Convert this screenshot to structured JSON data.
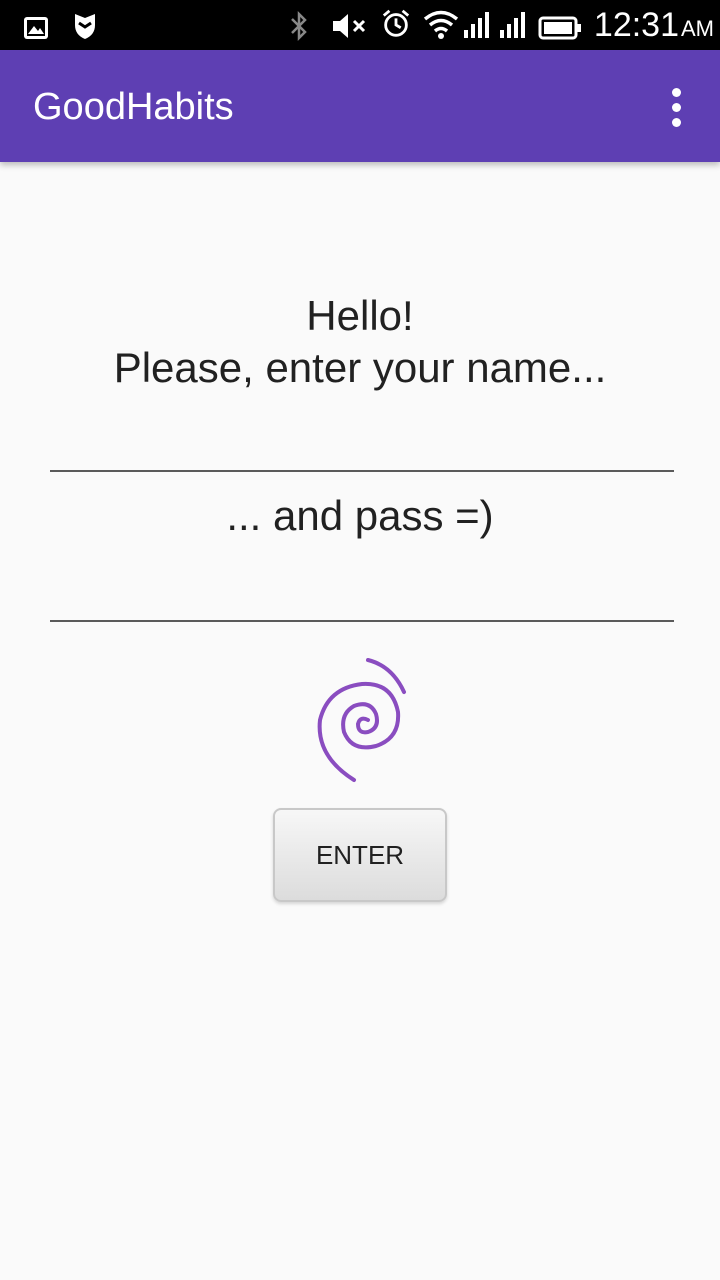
{
  "status_bar": {
    "time": "12:31",
    "ampm": "AM",
    "icons": [
      "image-icon",
      "shield-icon",
      "bluetooth-icon",
      "mute-icon",
      "alarm-icon",
      "wifi-icon",
      "signal-1-icon",
      "signal-2-icon",
      "battery-icon"
    ]
  },
  "app_bar": {
    "title": "GoodHabits",
    "menu_icon": "overflow-menu-icon",
    "color": "#5e3fb3"
  },
  "main": {
    "greeting_line1": "Hello!",
    "greeting_line2": "Please, enter your name...",
    "name_value": "",
    "pass_prompt": "... and pass =)",
    "pass_value": "",
    "logo_icon": "spiral-logo-icon",
    "enter_label": "ENTER"
  }
}
